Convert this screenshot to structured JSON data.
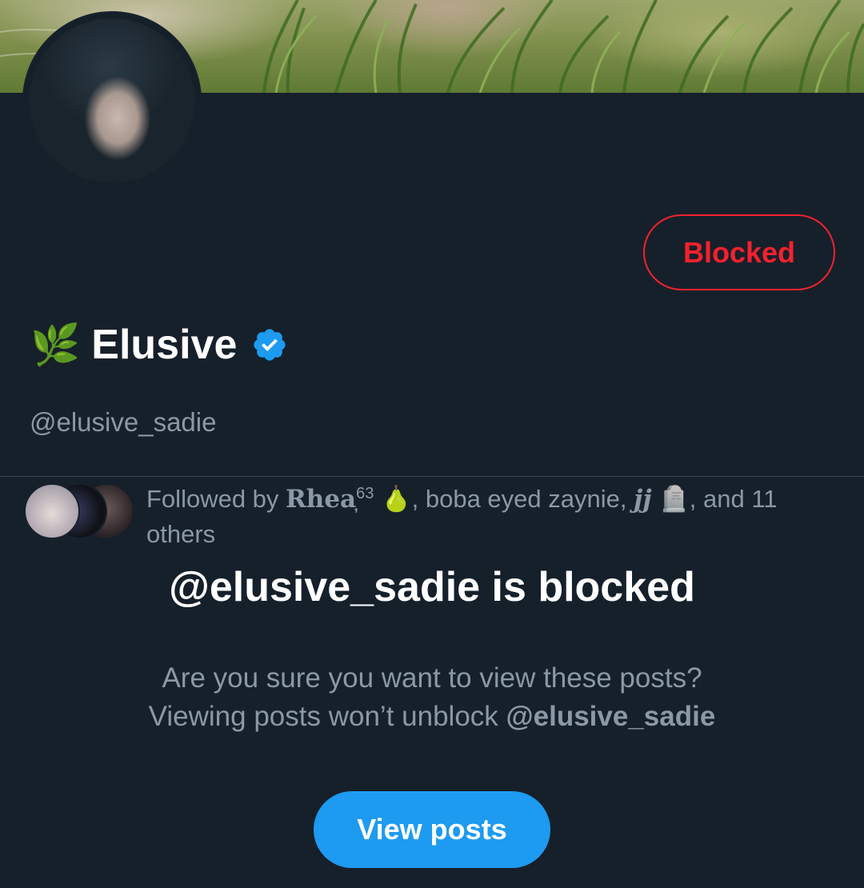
{
  "profile": {
    "display_name": "Elusive",
    "name_emoji": "🌿",
    "handle": "@elusive_sadie",
    "verified": true,
    "block_button_label": "Blocked"
  },
  "followed_by": {
    "prefix": "Followed by ",
    "name1": "Rhea",
    "name1_mark": "̦",
    "name1_sup": "63",
    "name1_emoji": " 🍐",
    "sep1": ", boba eyed zaynie, ",
    "name3": "jj",
    "name3_emoji": " 🪦",
    "suffix": ", and 11 others"
  },
  "blocked_notice": {
    "title": "@elusive_sadie is blocked",
    "line1": "Are you sure you want to view these posts?",
    "line2_prefix": "Viewing posts won’t unblock ",
    "line2_handle": "@elusive_sadie",
    "button_label": "View posts"
  },
  "colors": {
    "background": "#15202b",
    "block_red": "#f4212e",
    "accent_blue": "#1d9bf0",
    "secondary_text": "#8b98a5"
  }
}
